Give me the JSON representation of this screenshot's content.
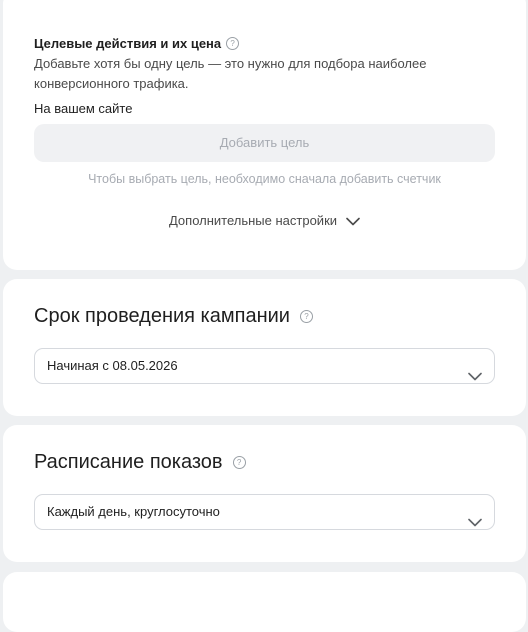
{
  "goals": {
    "title": "Целевые действия и их цена",
    "help_icon": "question-circle-icon",
    "description": "Добавьте хотя бы одну цель — это нужно для подбора наиболее конверсионного трафика.",
    "site_label": "На вашем сайте",
    "add_goal_label": "Добавить цель",
    "counter_hint": "Чтобы выбрать цель, необходимо сначала добавить счетчик",
    "more_settings_label": "Дополнительные настройки"
  },
  "duration": {
    "title": "Срок проведения кампании",
    "help_icon": "question-circle-icon",
    "selected": "Начиная с 08.05.2026"
  },
  "schedule": {
    "title": "Расписание показов",
    "help_icon": "question-circle-icon",
    "selected": "Каждый день, круглосуточно"
  },
  "colors": {
    "background": "#eef0f2",
    "card": "#ffffff",
    "disabled_text": "#a7abb2"
  }
}
